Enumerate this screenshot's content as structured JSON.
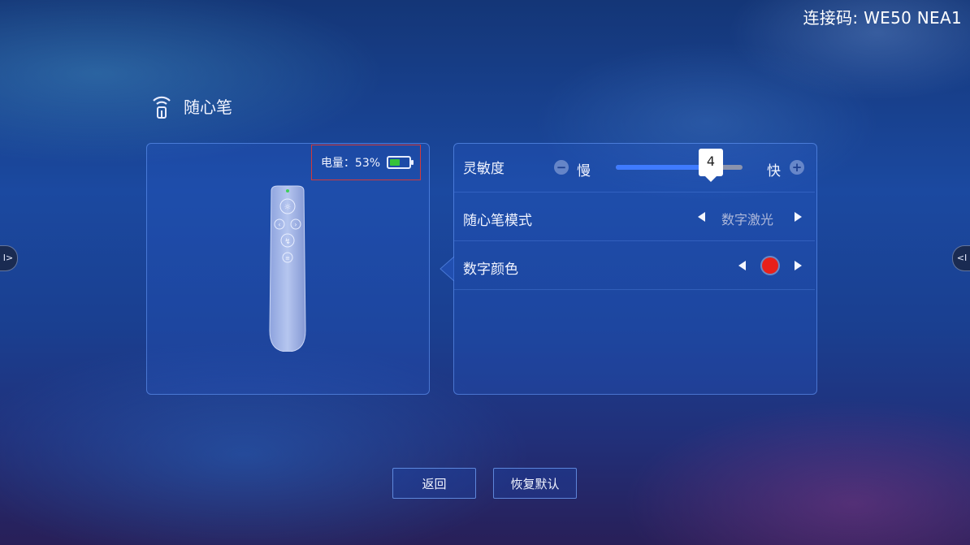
{
  "connection_code": "连接码: WE50 NEA1",
  "page": {
    "title": "随心笔",
    "icon": "wireless-pen-icon"
  },
  "device_panel": {
    "battery_label": "电量：53%",
    "battery_level": 0.53,
    "battery_color": "#35c23a"
  },
  "settings": {
    "sensitivity": {
      "label": "灵敏度",
      "slow_label": "慢",
      "fast_label": "快",
      "value": "4",
      "level": 0.67
    },
    "pen_mode": {
      "label": "随心笔模式",
      "value": "数字激光"
    },
    "digital_color": {
      "label": "数字颜色",
      "color": "#e8201a"
    }
  },
  "buttons": {
    "back": "返回",
    "restore_default": "恢复默认"
  },
  "side_tabs": {
    "left_icon": "expand-left-icon",
    "right_icon": "expand-right-icon"
  }
}
